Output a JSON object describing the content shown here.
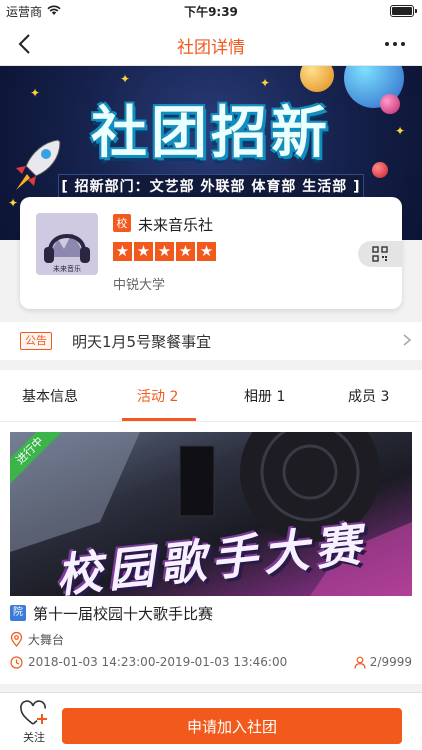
{
  "status_bar": {
    "carrier": "运营商",
    "time": "下午9:39",
    "battery_level": 1.0
  },
  "nav": {
    "title": "社团详情"
  },
  "banner": {
    "title": "社团招新",
    "subtitle": "[ 招新部门：文艺部 外联部 体育部 生活部 ]"
  },
  "club": {
    "school_badge": "校",
    "name": "未来音乐社",
    "rating": 5,
    "school": "中锐大学"
  },
  "notice": {
    "tag": "公告",
    "text": "明天1月5号聚餐事宜"
  },
  "tabs": [
    {
      "label": "基本信息"
    },
    {
      "label": "活动 2"
    },
    {
      "label": "相册 1"
    },
    {
      "label": "成员 3"
    }
  ],
  "active_tab": 1,
  "activity": {
    "status": "进行中",
    "banner_text": "校园歌手大赛",
    "type_badge": "院",
    "title": "第十一届校园十大歌手比赛",
    "location": "大舞台",
    "time": "2018-01-03 14:23:00-2019-01-03 13:46:00",
    "count": "2/9999"
  },
  "bottom": {
    "follow_label": "关注",
    "join_label": "申请加入社团"
  },
  "colors": {
    "accent": "#f25a1d",
    "status_green": "#3bb54a",
    "type_blue": "#3d7bd9"
  }
}
